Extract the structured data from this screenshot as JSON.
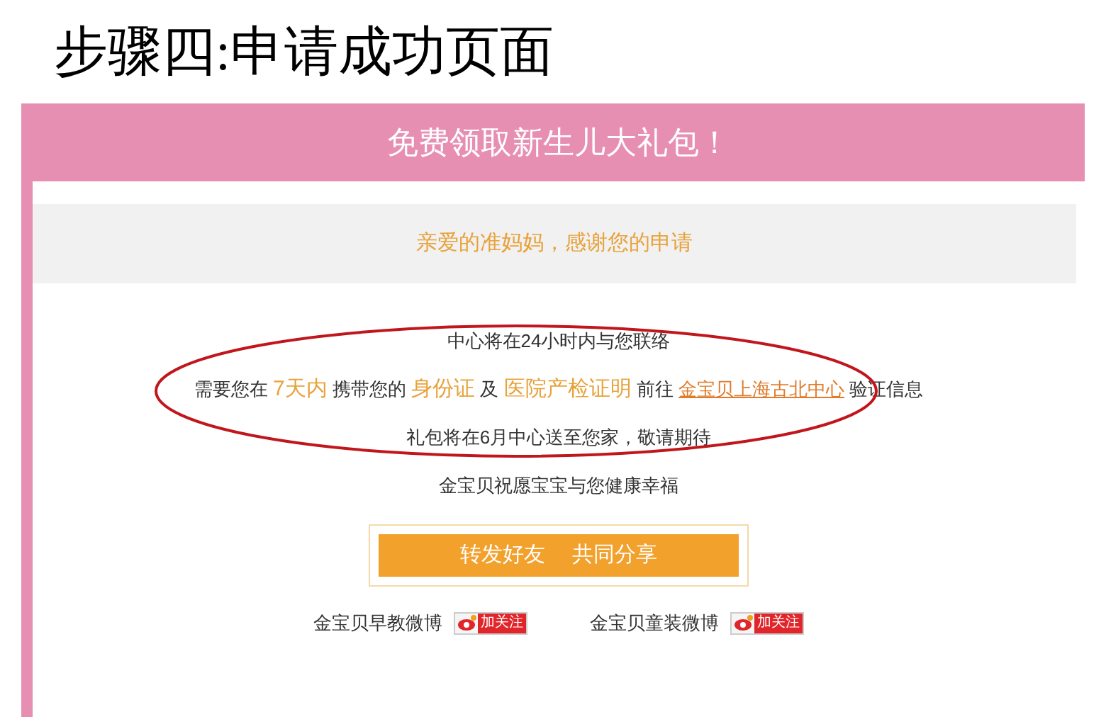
{
  "slide_title": "步骤四:申请成功页面",
  "page": {
    "banner": "免费领取新生儿大礼包！",
    "thanks": "亲爱的准妈妈，感谢您的申请",
    "lines": [
      {
        "segments": [
          {
            "kind": "plain",
            "text": "中心将在24小时内与您联络"
          }
        ]
      },
      {
        "segments": [
          {
            "kind": "plain",
            "text": "需要您在 "
          },
          {
            "kind": "highlight",
            "text": "7天内"
          },
          {
            "kind": "plain",
            "text": " 携带您的 "
          },
          {
            "kind": "highlight",
            "text": "身份证"
          },
          {
            "kind": "plain",
            "text": " 及 "
          },
          {
            "kind": "highlight",
            "text": "医院产检证明"
          },
          {
            "kind": "plain",
            "text": " 前往 "
          },
          {
            "kind": "link",
            "text": "金宝贝上海古北中心"
          },
          {
            "kind": "plain",
            "text": " 验证信息"
          }
        ]
      },
      {
        "segments": [
          {
            "kind": "plain",
            "text": "礼包将在6月中心送至您家，敬请期待"
          }
        ]
      },
      {
        "segments": [
          {
            "kind": "plain",
            "text": "金宝贝祝愿宝宝与您健康幸福"
          }
        ]
      }
    ],
    "share_button": "转发好友　 共同分享",
    "weibo": [
      {
        "label": "金宝贝早教微博",
        "follow": "加关注"
      },
      {
        "label": "金宝贝童装微博",
        "follow": "加关注"
      }
    ]
  }
}
